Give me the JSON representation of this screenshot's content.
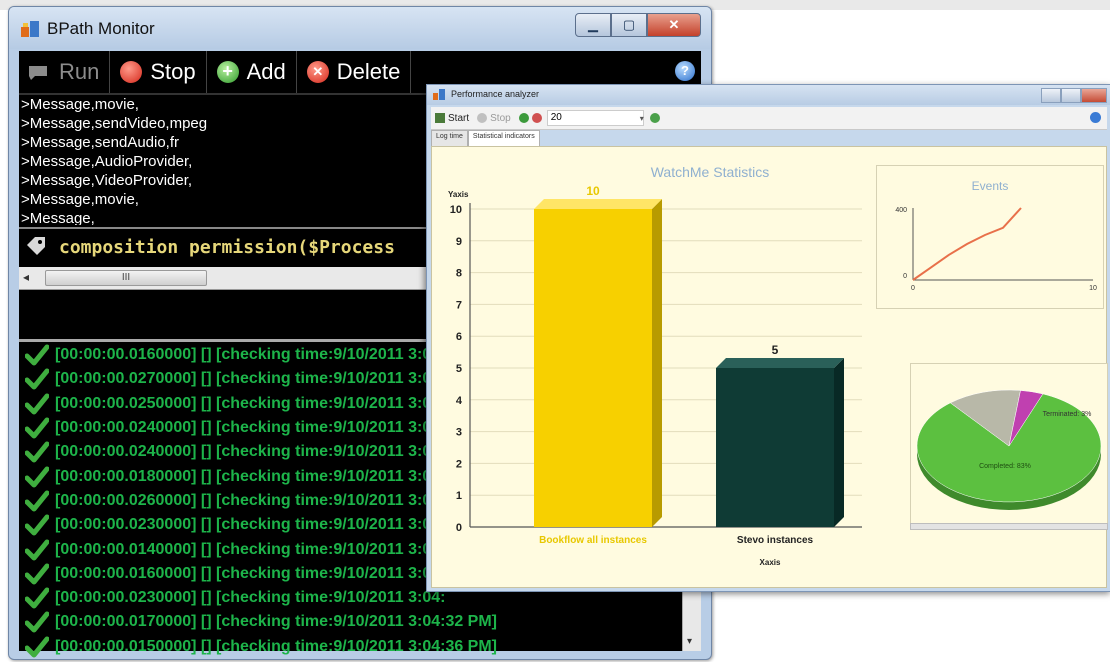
{
  "monitor": {
    "title": "BPath Monitor",
    "toolbar": {
      "run_label": "Run",
      "stop_label": "Stop",
      "add_label": "Add",
      "delete_label": "Delete"
    },
    "messages": [
      ">Message,movie,",
      ">Message,sendVideo,mpeg",
      ">Message,sendAudio,fr",
      ">Message,AudioProvider,",
      ">Message,VideoProvider,",
      ">Message,movie,",
      ">Message,"
    ],
    "formula": "composition permission($Process",
    "scroll_thumb": "III",
    "log": [
      "[00:00:00.0160000] [] [checking time:9/10/2011 3:04:",
      "[00:00:00.0270000] [] [checking time:9/10/2011 3:04:",
      "[00:00:00.0250000] [] [checking time:9/10/2011 3:04:",
      "[00:00:00.0240000] [] [checking time:9/10/2011 3:04:",
      "[00:00:00.0240000] [] [checking time:9/10/2011 3:04:",
      "[00:00:00.0180000] [] [checking time:9/10/2011 3:04:",
      "[00:00:00.0260000] [] [checking time:9/10/2011 3:04:",
      "[00:00:00.0230000] [] [checking time:9/10/2011 3:04:",
      "[00:00:00.0140000] [] [checking time:9/10/2011 3:04:",
      "[00:00:00.0160000] [] [checking time:9/10/2011 3:04:",
      "[00:00:00.0230000] [] [checking time:9/10/2011 3:04:",
      "[00:00:00.0170000] [] [checking time:9/10/2011 3:04:32 PM]",
      "[00:00:00.0150000] [] [checking time:9/10/2011 3:04:36 PM]"
    ]
  },
  "analyzer": {
    "title": "Performance analyzer",
    "toolbar": {
      "start_label": "Start",
      "stop_label": "Stop",
      "count_value": "20"
    },
    "tabs": [
      "Log time",
      "Statistical indicators"
    ],
    "colors": {
      "bar1": "#f7d000",
      "bar2": "#0f3b35",
      "pie_completed": "#5cc040",
      "pie_terminated": "#b8b8a8",
      "pie_other": "#c040b0"
    }
  },
  "chart_data": [
    {
      "type": "bar",
      "title": "WatchMe Statistics",
      "xlabel": "Xaxis",
      "ylabel": "Yaxis",
      "categories": [
        "Bookflow all instances",
        "Stevo instances"
      ],
      "values": [
        10,
        5
      ],
      "value_labels": [
        "10",
        "5"
      ],
      "y_ticks": [
        "0",
        "1",
        "2",
        "3",
        "4",
        "5",
        "6",
        "7",
        "8",
        "9",
        "10"
      ],
      "ylim": [
        0,
        10
      ],
      "grid": true
    },
    {
      "type": "line",
      "title": "Events",
      "x": [
        0,
        1,
        2,
        3,
        4,
        5,
        6
      ],
      "y": [
        0,
        70,
        140,
        200,
        250,
        290,
        400
      ],
      "xlim": [
        0,
        10
      ],
      "ylim": [
        0,
        400
      ],
      "x_tick_labels": [
        "0",
        "10"
      ],
      "y_tick_labels": [
        "0",
        "400"
      ]
    },
    {
      "type": "pie",
      "slices": [
        {
          "label": "Completed: 83%",
          "value": 83
        },
        {
          "label": "Terminated: 3%",
          "value": 13
        },
        {
          "label": "",
          "value": 4
        }
      ]
    }
  ]
}
